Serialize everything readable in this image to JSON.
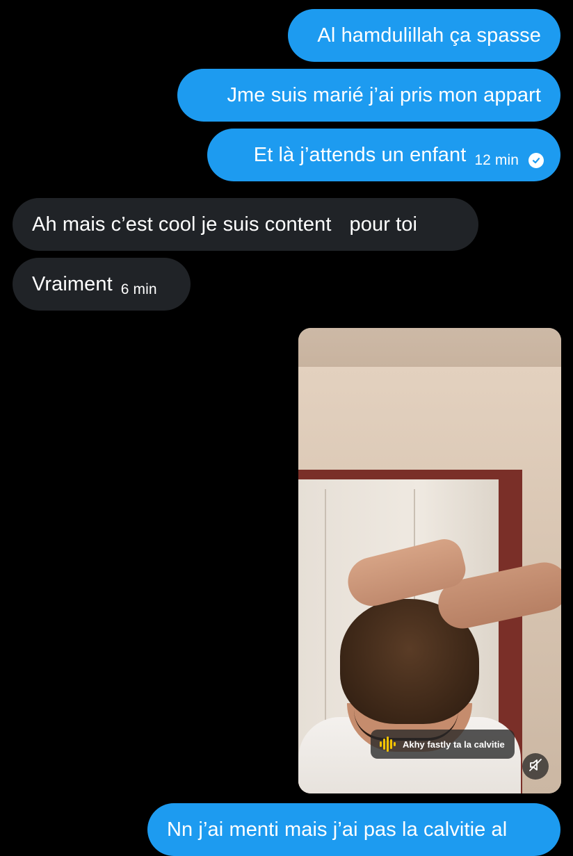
{
  "messages": {
    "out1": {
      "text": "Al hamdulillah ça spasse"
    },
    "out2": {
      "text": "Jme suis marié j’ai pris mon appart"
    },
    "out3": {
      "text": "Et là j’attends un enfant",
      "time": "12 min",
      "status_icon": "read-check-icon"
    },
    "in1": {
      "text": "Ah mais c’est cool je suis content",
      "text2": "pour toi"
    },
    "in2": {
      "text": "Vraiment",
      "time": "6 min"
    },
    "video": {
      "caption": "Akhy fastly ta la calvitie",
      "sound_icon": "audio-waveform-icon",
      "mute_icon": "muted-speaker-icon"
    },
    "out4": {
      "text": "Nn j’ai menti mais j’ai pas la calvitie al"
    }
  },
  "colors": {
    "background": "#000000",
    "outgoing_bubble": "#1d9bf0",
    "incoming_bubble": "#202327",
    "text": "#ffffff",
    "waveform": "#f5c400"
  }
}
